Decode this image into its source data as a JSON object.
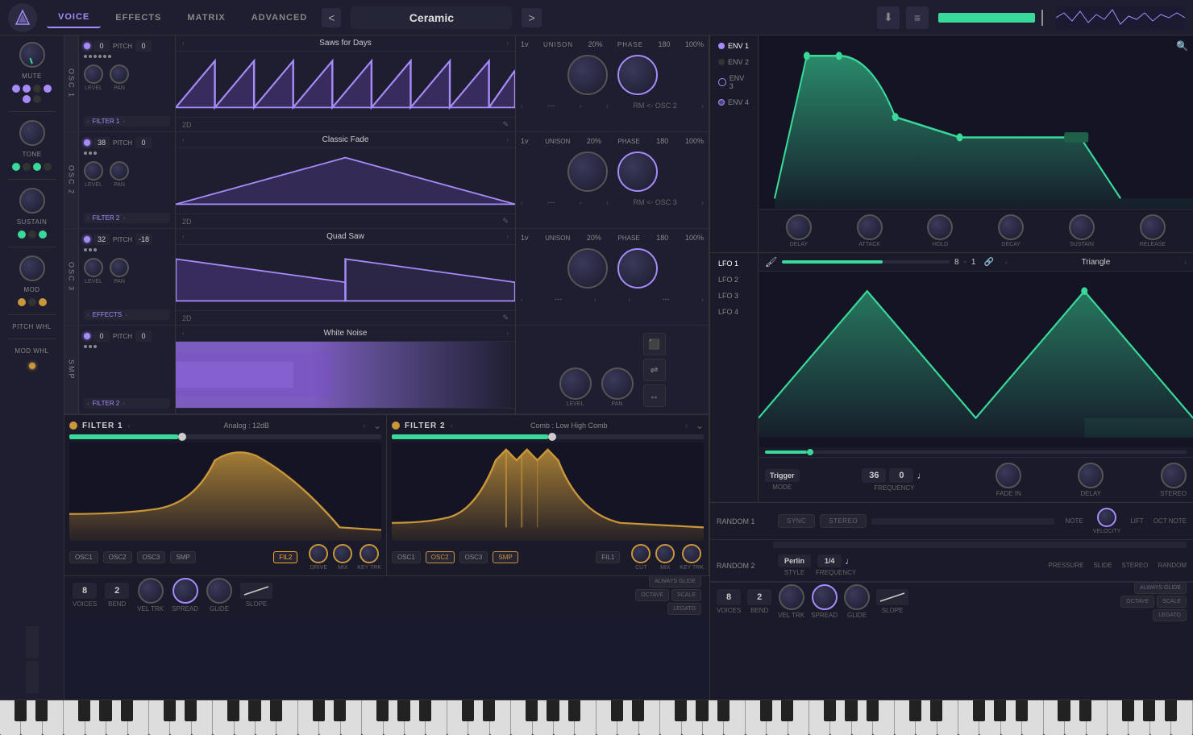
{
  "header": {
    "logo_alt": "Vital Logo",
    "nav_tabs": [
      "VOICE",
      "EFFECTS",
      "MATRIX",
      "ADVANCED"
    ],
    "active_tab": "VOICE",
    "preset_name": "Ceramic",
    "nav_prev": "<",
    "nav_next": ">",
    "save_btn": "⬇",
    "menu_btn": "≡"
  },
  "left_sidebar": {
    "knob1_label": "MUTE",
    "knob2_label": "TONE",
    "knob3_label": "SUSTAIN",
    "knob4_label": "MOD",
    "knob5_label": "PITCH WHL",
    "knob6_label": "MOD WHL"
  },
  "osc1": {
    "label": "OSC 1",
    "pitch_left": "0",
    "pitch_label": "PITCH",
    "pitch_right": "0",
    "waveform_name": "Saws for Days",
    "dim_label": "2D",
    "filter_label": "FILTER 1",
    "unison_label": "UNISON",
    "unison_val": "1v",
    "unison_pct": "20%",
    "phase_label": "PHASE",
    "phase_num": "180",
    "phase_pct": "100%",
    "bottom_left": "---",
    "bottom_right": "RM <- OSC 2"
  },
  "osc2": {
    "label": "OSC 2",
    "pitch_left": "38",
    "pitch_label": "PITCH",
    "pitch_right": "0",
    "waveform_name": "Classic Fade",
    "dim_label": "2D",
    "filter_label": "FILTER 2",
    "unison_val": "1v",
    "unison_pct": "20%",
    "phase_num": "180",
    "phase_pct": "100%",
    "bottom_left": "---",
    "bottom_right": "RM <- OSC 3"
  },
  "osc3": {
    "label": "OSC 3",
    "pitch_left": "32",
    "pitch_label": "PITCH",
    "pitch_right": "-18",
    "waveform_name": "Quad Saw",
    "dim_label": "2D",
    "filter_label": "EFFECTS",
    "unison_val": "1v",
    "unison_pct": "20%",
    "phase_num": "180",
    "phase_pct": "100%",
    "bottom_left": "---",
    "bottom_right": "---"
  },
  "smp": {
    "label": "SMP",
    "pitch_left": "0",
    "pitch_right": "0",
    "waveform_name": "White Noise",
    "filter_label": "FILTER 2",
    "level_label": "LEVEL",
    "pan_label": "PAN"
  },
  "filter1": {
    "label": "FILTER 1",
    "preset": "Analog : 12dB",
    "sources": [
      "OSC1",
      "OSC2",
      "OSC3",
      "SMP"
    ],
    "active_source": "FIL2",
    "drive_label": "DRIVE",
    "mix_label": "MIX",
    "keytrk_label": "KEY TRK"
  },
  "filter2": {
    "label": "FILTER 2",
    "preset": "Comb : Low High Comb",
    "sources": [
      "OSC1",
      "OSC2",
      "OSC3",
      "SMP"
    ],
    "active_source": "FIL1",
    "cut_label": "CUT",
    "mix_label": "MIX",
    "keytrk_label": "KEY TRK"
  },
  "env": {
    "tabs": [
      "ENV 1",
      "ENV 2",
      "ENV 3",
      "ENV 4"
    ],
    "active": "ENV 1",
    "knobs": [
      "DELAY",
      "ATTACK",
      "HOLD",
      "DECAY",
      "SUSTAIN",
      "RELEASE"
    ],
    "search_icon": "🔍"
  },
  "lfo": {
    "tabs": [
      "LFO 1",
      "LFO 2",
      "LFO 3",
      "LFO 4"
    ],
    "active": "LFO 1",
    "rate_num": "8",
    "rate_denom": "1",
    "shape_name": "Triangle",
    "mode_label": "MODE",
    "mode_val": "Trigger",
    "freq_label": "FREQUENCY",
    "freq_num": "36",
    "freq_num2": "0",
    "fade_in_label": "FADE IN",
    "delay_label": "DELAY",
    "stereo_label": "STEREO",
    "tempo_icon": "🎵"
  },
  "random": {
    "random1_label": "RANDOM 1",
    "random2_label": "RANDOM 2",
    "buttons": [
      "SYNC",
      "STEREO"
    ],
    "note_label": "NOTE",
    "velocity_label": "VELOCITY",
    "lift_label": "LIFT",
    "oct_note_label": "OCT NOTE",
    "pressure_label": "PRESSURE",
    "slide_label": "SLIDE",
    "stereo_label": "STEREO",
    "random_label": "RANDOM",
    "style_label": "STYLE",
    "style_val": "Perlin",
    "freq_label": "FREQUENCY",
    "freq_val": "1/4"
  },
  "bottom": {
    "voices_label": "VOICES",
    "voices_val": "8",
    "bend_label": "BEND",
    "bend_val": "2",
    "veltrk_label": "VEL TRK",
    "spread_label": "SPREAD",
    "glide_label": "GLIDE",
    "slope_label": "SLOPE",
    "always_glide": "ALWAYS GLIDE",
    "octave_label": "OCTAVE",
    "scale_label": "SCALE",
    "legato_label": "LEGATO"
  }
}
